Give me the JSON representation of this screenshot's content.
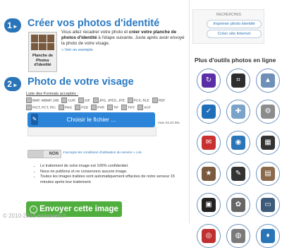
{
  "step1": {
    "num": "1",
    "title": "Créer vos photos d'identité"
  },
  "sample": {
    "caption": "Planche de Photos d'identité"
  },
  "intro": {
    "p1": "Vous allez recadrer votre photo et ",
    "p1b": "créer votre planche de photos d'identité",
    "p2": " à l'étape suivante. Juste après avoir envoyé la photo de votre visage.",
    "see_example": "» Voir un exemple"
  },
  "step2": {
    "num": "2",
    "title": "Photo de votre visage"
  },
  "formats": {
    "label": "Liste des Formats acceptés :",
    "items": [
      "BMP, WBMP, DIB",
      "CUR",
      "GIF",
      "JPG, JPEG, JPE",
      "PCX, RLE",
      "PDF",
      "PICT, PCT, PIC",
      "PNG",
      "PSD",
      "PXR",
      "TIF",
      "TIFF",
      "XCF"
    ]
  },
  "upload": {
    "choose_label": "Choisir le fichier ...",
    "clip_icon": "paperclip-icon",
    "max_size": "max 24,41 Mo."
  },
  "toggle": {
    "state": "NON"
  },
  "accept": {
    "text": "J'accepte les conditions d'utilisation du service » Lire"
  },
  "bullets": [
    "Le traitement de votre image est 100% confidentiel.",
    "Nous ne publions et ne conservons aucune image.",
    "Toutes les images traitées sont automatiquement effacées de notre serveur 15 minutes après leur traitement."
  ],
  "send": {
    "label": "Envoyer cette image"
  },
  "copyright": "© 2010-2013 anthoweb.fr",
  "search": {
    "title": "RECHERCHES",
    "btn1": "Imprimer photo identité",
    "btn2": "Créer site Internet"
  },
  "side": {
    "title": "Plus d'outils photos en ligne"
  },
  "tools": [
    {
      "icon": "rotate-icon",
      "color": "#5a2ea6"
    },
    {
      "icon": "crop-icon",
      "color": "#2d2d2d"
    },
    {
      "icon": "pyramid-icon",
      "color": "#6d8fb8"
    },
    {
      "icon": "check-icon",
      "color": "#1f6fb8"
    },
    {
      "icon": "puzzle-icon",
      "color": "#7aa3c9"
    },
    {
      "icon": "gears-icon",
      "color": "#8c8c8c"
    },
    {
      "icon": "stamp-icon",
      "color": "#c93030"
    },
    {
      "icon": "globe-icon",
      "color": "#2a74b8"
    },
    {
      "icon": "blocks-icon",
      "color": "#333333"
    },
    {
      "icon": "certificate-icon",
      "color": "#7a5a3e"
    },
    {
      "icon": "pencil-icon",
      "color": "#333333"
    },
    {
      "icon": "calendar-icon",
      "color": "#8a6a4a"
    },
    {
      "icon": "tv-icon",
      "color": "#222222"
    },
    {
      "icon": "ornament-icon",
      "color": "#666666"
    },
    {
      "icon": "frame-icon",
      "color": "#3d5a7a"
    },
    {
      "icon": "glasses-icon",
      "color": "#c03030"
    },
    {
      "icon": "disc-icon",
      "color": "#7a7a7a"
    },
    {
      "icon": "cards-icon",
      "color": "#2a74b8"
    }
  ]
}
